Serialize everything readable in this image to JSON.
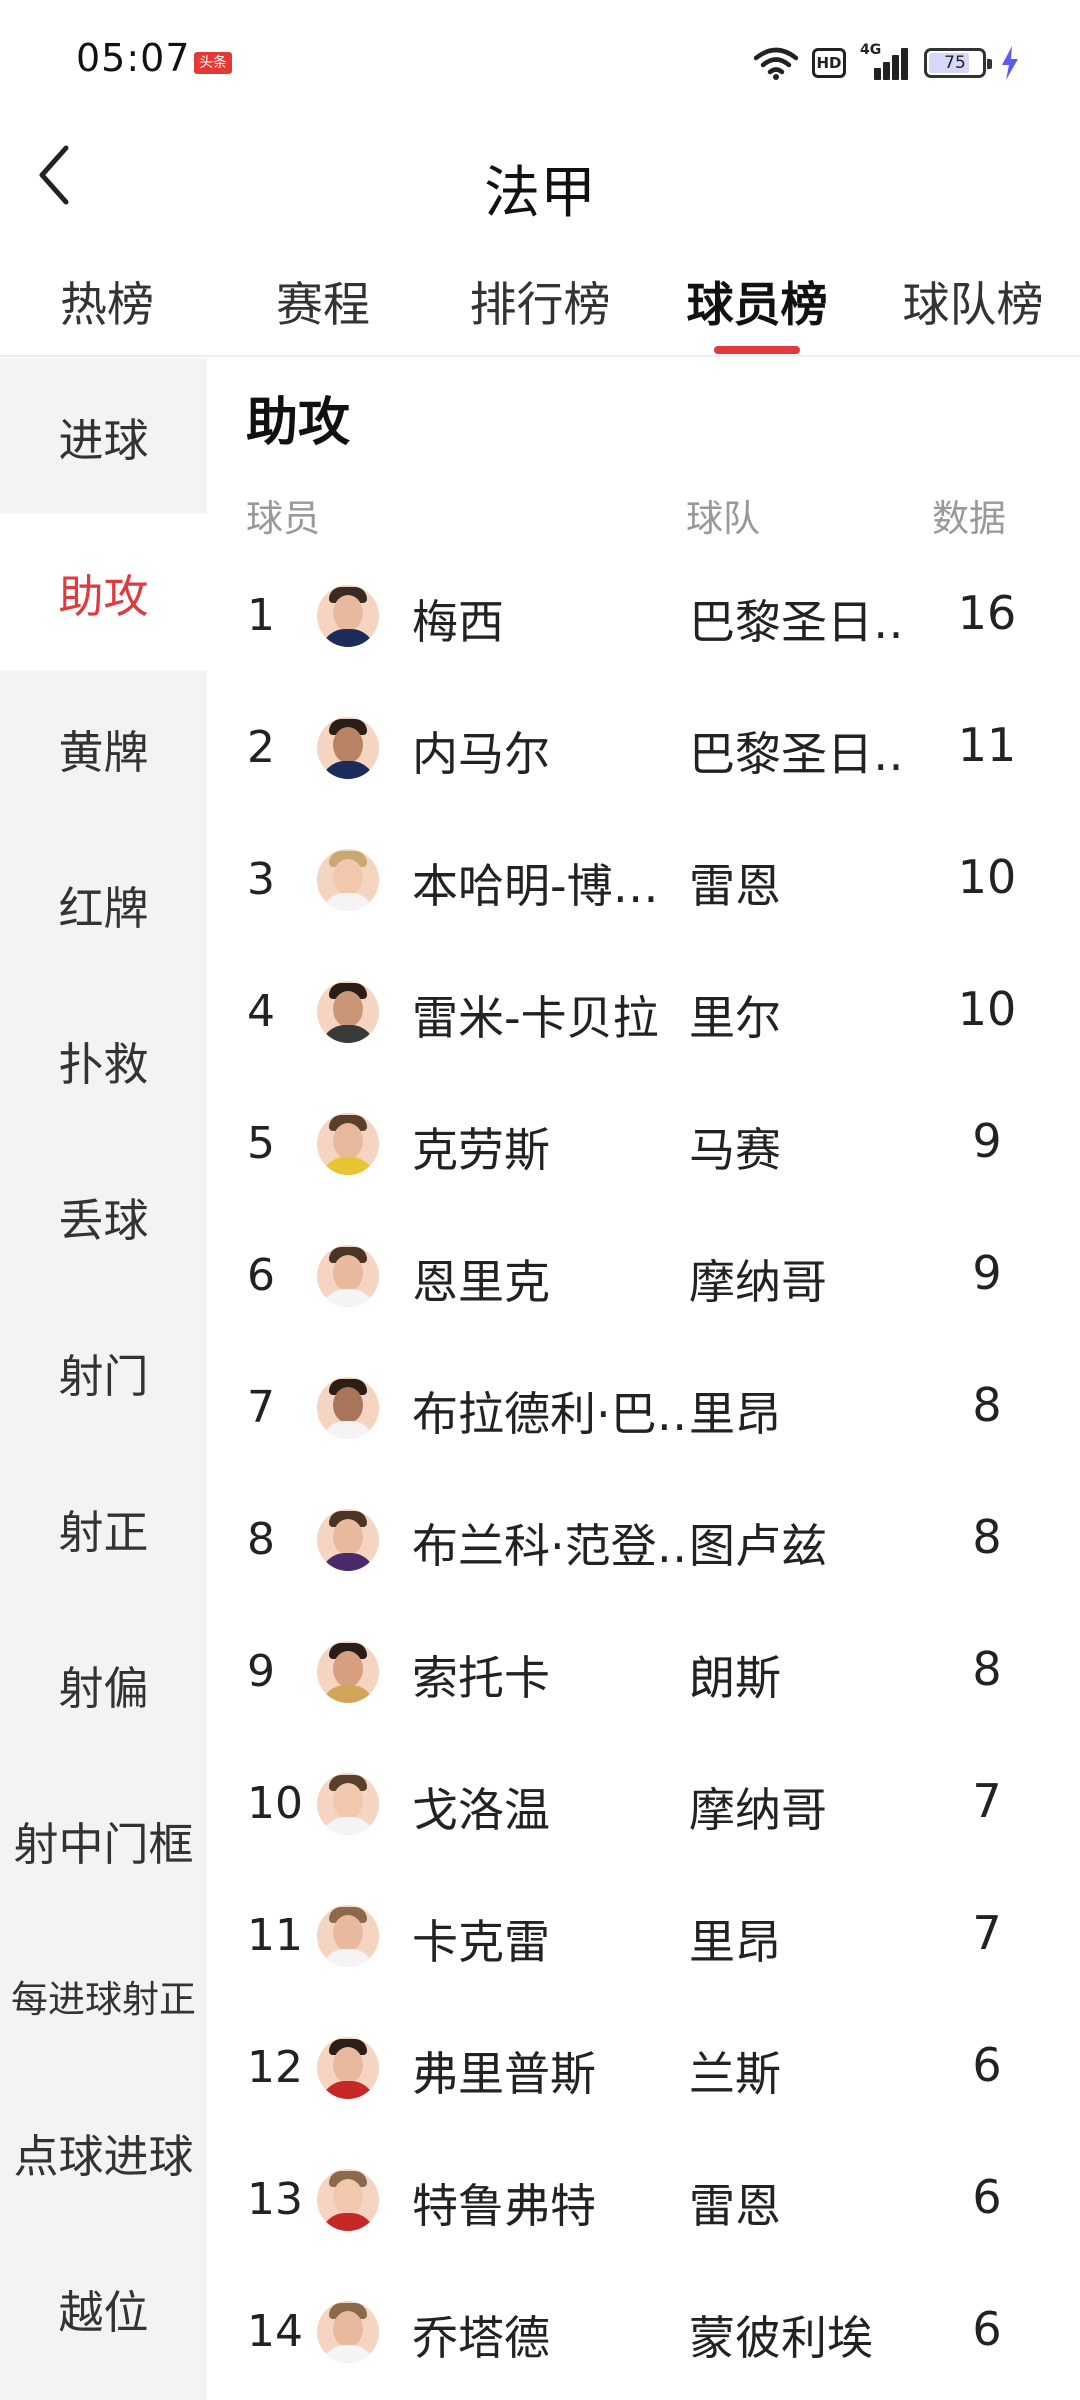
{
  "status_bar": {
    "time": "05:07",
    "app_badge": "头条",
    "hd_label": "HD",
    "network": "4G",
    "battery": "75",
    "icons": [
      "wifi-icon",
      "hd-icon",
      "signal-4g-icon",
      "battery-icon",
      "charging-bolt-icon"
    ]
  },
  "header": {
    "title": "法甲",
    "back_icon": "chevron-left-icon"
  },
  "tabs": [
    {
      "label": "热榜",
      "active": false
    },
    {
      "label": "赛程",
      "active": false
    },
    {
      "label": "排行榜",
      "active": false
    },
    {
      "label": "球员榜",
      "active": true
    },
    {
      "label": "球队榜",
      "active": false
    }
  ],
  "sidebar": {
    "items": [
      {
        "label": "进球"
      },
      {
        "label": "助攻",
        "active": true
      },
      {
        "label": "黄牌"
      },
      {
        "label": "红牌"
      },
      {
        "label": "扑救"
      },
      {
        "label": "丢球"
      },
      {
        "label": "射门"
      },
      {
        "label": "射正"
      },
      {
        "label": "射偏"
      },
      {
        "label": "射中门框"
      },
      {
        "label": "每进球射正"
      },
      {
        "label": "点球进球"
      },
      {
        "label": "越位"
      }
    ]
  },
  "main": {
    "section_title": "助攻",
    "columns": {
      "player": "球员",
      "team": "球队",
      "value": "数据"
    },
    "rows": [
      {
        "rank": "1",
        "name": "梅西",
        "team": "巴黎圣日…",
        "value": "16"
      },
      {
        "rank": "2",
        "name": "内马尔",
        "team": "巴黎圣日…",
        "value": "11"
      },
      {
        "rank": "3",
        "name": "本哈明-博…",
        "team": "雷恩",
        "value": "10"
      },
      {
        "rank": "4",
        "name": "雷米-卡贝拉",
        "team": "里尔",
        "value": "10"
      },
      {
        "rank": "5",
        "name": "克劳斯",
        "team": "马赛",
        "value": "9"
      },
      {
        "rank": "6",
        "name": "恩里克",
        "team": "摩纳哥",
        "value": "9"
      },
      {
        "rank": "7",
        "name": "布拉德利·巴…",
        "team": "里昂",
        "value": "8"
      },
      {
        "rank": "8",
        "name": "布兰科·范登…",
        "team": "图卢兹",
        "value": "8"
      },
      {
        "rank": "9",
        "name": "索托卡",
        "team": "朗斯",
        "value": "8"
      },
      {
        "rank": "10",
        "name": "戈洛温",
        "team": "摩纳哥",
        "value": "7"
      },
      {
        "rank": "11",
        "name": "卡克雷",
        "team": "里昂",
        "value": "7"
      },
      {
        "rank": "12",
        "name": "弗里普斯",
        "team": "兰斯",
        "value": "6"
      },
      {
        "rank": "13",
        "name": "特鲁弗特",
        "team": "雷恩",
        "value": "6"
      },
      {
        "rank": "14",
        "name": "乔塔德",
        "team": "蒙彼利埃",
        "value": "6"
      }
    ]
  },
  "colors": {
    "accent": "#e0393e",
    "sidebar_bg": "#f2f3f5",
    "muted_text": "#999999"
  }
}
